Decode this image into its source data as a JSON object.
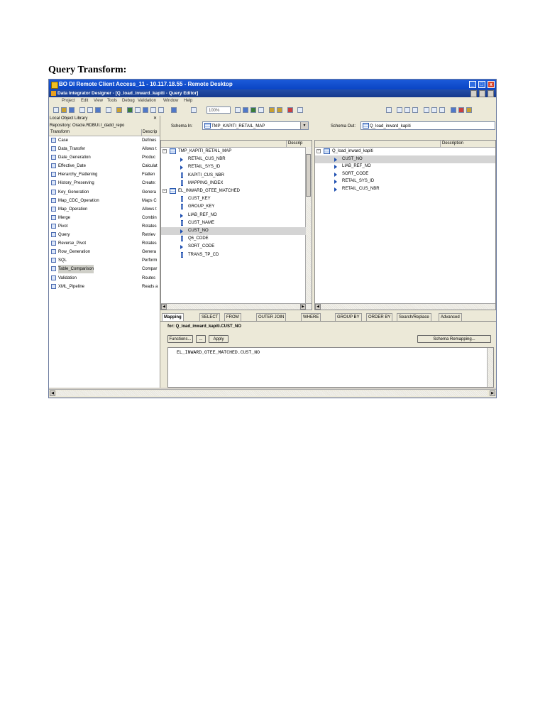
{
  "heading": "Query Transform:",
  "remote_title": "BO DI Remote Client Access_11 - 10.117.18.55 - Remote Desktop",
  "app_title": "Data Integrator Designer - [Q_load_inward_kapiti - Query Editor]",
  "menu": [
    "Project",
    "Edit",
    "View",
    "Tools",
    "Debug",
    "Validation",
    "Window",
    "Help"
  ],
  "zoom": "100%",
  "library": {
    "title": "Local Object Library",
    "close": "✕",
    "repository": "Repository: Oracle.RDBUI.I_dadd_repo",
    "col_transform": "Transform",
    "col_desc": "Descrip",
    "items": [
      {
        "name": "Case",
        "desc": "Defines"
      },
      {
        "name": "Data_Transfer",
        "desc": "Allows t"
      },
      {
        "name": "Date_Generation",
        "desc": "Produc"
      },
      {
        "name": "Effective_Date",
        "desc": "Calculat"
      },
      {
        "name": "Hierarchy_Flattening",
        "desc": "Flatten"
      },
      {
        "name": "History_Preserving",
        "desc": "Create:"
      },
      {
        "name": "Key_Generation",
        "desc": "Genera"
      },
      {
        "name": "Map_CDC_Operation",
        "desc": "Maps C"
      },
      {
        "name": "Map_Operation",
        "desc": "Allows t"
      },
      {
        "name": "Merge",
        "desc": "Combin"
      },
      {
        "name": "Pivot",
        "desc": "Rotates"
      },
      {
        "name": "Query",
        "desc": "Retriev"
      },
      {
        "name": "Reverse_Pivot",
        "desc": "Rotates"
      },
      {
        "name": "Row_Generation",
        "desc": "Genera"
      },
      {
        "name": "SQL",
        "desc": "Perform"
      },
      {
        "name": "Table_Comparison",
        "desc": "Compar"
      },
      {
        "name": "Validation",
        "desc": "Routes"
      },
      {
        "name": "XML_Pipeline",
        "desc": "Reads a"
      }
    ]
  },
  "schema_in": {
    "label": "Schema In:",
    "value": "TMP_KAPITI_RETAIL_MAP",
    "col_desc": "Descrip",
    "tables": [
      {
        "name": "TMP_KAPITI_RETAIL_MAP",
        "cols": [
          "RETAIL_CUS_NBR",
          "RETAIL_SYS_ID",
          "KAPITI_CUS_NBR",
          "MAPPING_INDEX"
        ]
      },
      {
        "name": "EL_INWARD_GTEE_MATCHED",
        "cols": [
          "CUST_KEY",
          "GROUP_KEY",
          "LIAB_REF_NO",
          "CUST_NAME",
          "CUST_NO",
          "Q6_CODE",
          "SORT_CODE",
          "TRANS_TP_CD"
        ]
      }
    ]
  },
  "schema_out": {
    "label": "Schema Out:",
    "value": "Q_load_inward_kapiti",
    "col_desc": "Description",
    "root": "Q_load_inward_kapiti",
    "cols": [
      "CUST_NO",
      "LIAB_REF_NO",
      "SORT_CODE",
      "RETAIL_SYS_ID",
      "RETAIL_CUS_NBR"
    ]
  },
  "tabs": [
    "Mapping",
    "SELECT",
    "FROM",
    "OUTER JOIN",
    "WHERE",
    "GROUP BY",
    "ORDER BY",
    "Search/Replace",
    "Advanced"
  ],
  "for_label": "for: Q_load_inward_kapiti.CUST_NO",
  "buttons": {
    "functions": "Functions...",
    "ellipsis": "...",
    "apply": "Apply",
    "remapping": "Schema Remapping..."
  },
  "mapping_expression": "EL_INWARD_GTEE_MATCHED.CUST_NO"
}
